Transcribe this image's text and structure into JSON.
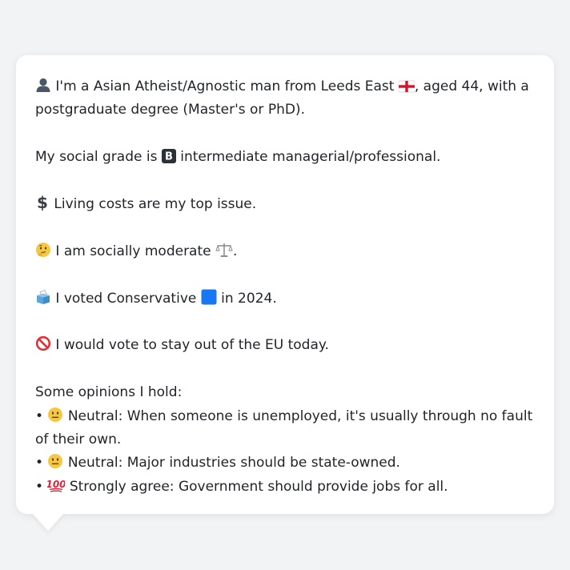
{
  "profile": {
    "intro": {
      "icon": "person-silhouette-icon",
      "text_before_flag": "I'm a Asian Atheist/Agnostic man from Leeds East",
      "flag_icon": "england-flag-icon",
      "text_after_flag": ", aged 44, with a postgraduate degree (Master's or PhD)."
    },
    "social_grade": {
      "text_before": "My social grade is",
      "badge_icon": "b-letter-badge-icon",
      "badge_letter": "B",
      "text_after": "intermediate managerial/professional."
    },
    "top_issue": {
      "icon": "dollar-sign-icon",
      "text": "Living costs are my top issue."
    },
    "social_stance": {
      "icon": "thinking-face-icon",
      "text": "I am socially moderate",
      "trail_icon": "balance-scale-icon",
      "trail_text": "."
    },
    "vote_2024": {
      "icon": "ballot-box-icon",
      "text_before": "I voted Conservative",
      "party_icon": "blue-square-icon",
      "text_after": "in 2024."
    },
    "eu_vote": {
      "icon": "prohibited-icon",
      "text": "I would vote to stay out of the EU today."
    },
    "opinions": {
      "heading": "Some opinions I hold:",
      "bullet": "•",
      "items": [
        {
          "icon": "neutral-face-icon",
          "text": "Neutral: When someone is unemployed, it's usually through no fault of their own."
        },
        {
          "icon": "neutral-face-icon",
          "text": "Neutral: Major industries should be state-owned."
        },
        {
          "icon": "hundred-points-icon",
          "text": "Strongly agree: Government should provide jobs for all."
        }
      ]
    }
  },
  "colors": {
    "background": "#f2f3f5",
    "bubble": "#ffffff",
    "text": "#1f2328",
    "conservative_blue": "#1877f2",
    "neutral_face": "#f6c741",
    "hundred_red": "#e0203a",
    "prohibited_red": "#e0303a"
  }
}
